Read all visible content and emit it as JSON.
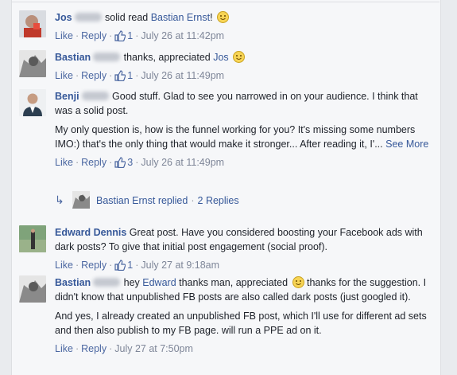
{
  "comments": [
    {
      "author": "Jos",
      "text_parts": [
        " solid read ",
        "Bastian Ernst",
        "!"
      ],
      "has_emoji": true,
      "actions": {
        "like": "Like",
        "reply": "Reply",
        "likes": "1",
        "time": "July 26 at 11:42pm"
      }
    },
    {
      "author": "Bastian",
      "text_parts": [
        " thanks, appreciated ",
        "Jos"
      ],
      "has_emoji": true,
      "actions": {
        "like": "Like",
        "reply": "Reply",
        "likes": "1",
        "time": "July 26 at 11:49pm"
      }
    },
    {
      "author": "Benji",
      "text": " Good stuff. Glad to see you narrowed in on your audience. I think that was a solid post.",
      "text2": "My only question is, how is the funnel working for you? It's missing some numbers IMO:) that's the only thing that would make it stronger... After reading it, I'...",
      "see_more": "See More",
      "actions": {
        "like": "Like",
        "reply": "Reply",
        "likes": "3",
        "time": "July 26 at 11:49pm"
      },
      "replies": {
        "replier": "Bastian Ernst replied",
        "count": "2 Replies"
      }
    },
    {
      "author": "Edward Dennis",
      "text": " Great post. Have you considered boosting your Facebook ads with dark posts? To give that initial post engagement (social proof).",
      "actions": {
        "like": "Like",
        "reply": "Reply",
        "likes": "1",
        "time": "July 27 at 9:18am"
      }
    },
    {
      "author": "Bastian",
      "text_a": " hey ",
      "mention": "Edward",
      "text_b": " thanks man, appreciated ",
      "text_c": " thanks for the suggestion. I didn't know that unpublished FB posts are also called dark posts (just googled it).",
      "text2": "And yes, I already created an unpublished FB post, which I'll use for different ad sets and then also publish to my FB page. will run a PPE ad on it.",
      "actions": {
        "like": "Like",
        "reply": "Reply",
        "time": "July 27 at 7:50pm"
      }
    }
  ],
  "separator": "·",
  "colors": {
    "link": "#365899",
    "meta": "#90949c",
    "background": "#f6f7f9"
  }
}
